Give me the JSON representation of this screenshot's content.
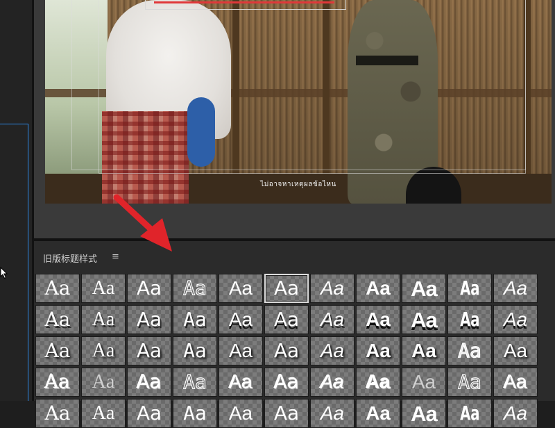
{
  "monitor": {
    "subtitle_text": "ไม่อาจหาเหตุผลข้อไหน"
  },
  "styles_panel": {
    "title": "旧版标题样式",
    "menu_icon_glyph": "≡",
    "sample_text": "Aa",
    "selected_index": 5
  },
  "colors": {
    "accent_blue": "#2d8ceb",
    "annotation_red": "#e0383a",
    "panel_bg": "#2b2b2b",
    "monitor_bg": "#3a3a3a"
  },
  "icons": {
    "cursor": "mouse-pointer-icon",
    "arrow": "red-annotation-arrow-icon",
    "menu": "hamburger-menu-icon"
  }
}
